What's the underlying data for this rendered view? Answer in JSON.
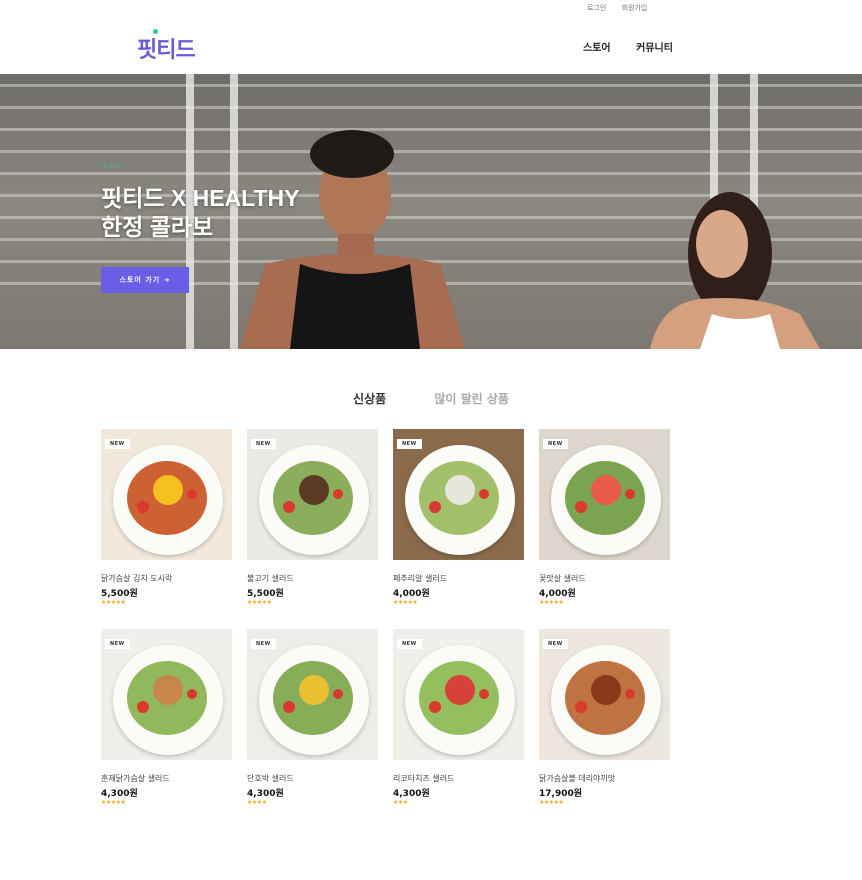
{
  "top_links": {
    "login": "로그인",
    "signup": "회원가입"
  },
  "logo": {
    "text": "핏티드"
  },
  "nav": {
    "store": "스토어",
    "community": "커뮤니티"
  },
  "hero": {
    "sub": "⚘⚘⚘",
    "title_line1": "핏티드 X HEALTHY",
    "title_line2": "한정 콜라보",
    "button": "스토어 가기 ➔"
  },
  "tabs": {
    "new": "신상품",
    "best": "많이 팔린 상품"
  },
  "products": [
    {
      "badge": "NEW",
      "name": "닭가슴살 김치 도시락",
      "price": "5,500원",
      "stars": "★★★★★",
      "colors": [
        "#f2e9dc",
        "#c8501e",
        "#f6c021"
      ]
    },
    {
      "badge": "NEW",
      "name": "불고기 샐러드",
      "price": "5,500원",
      "stars": "★★★★★",
      "colors": [
        "#eceae4",
        "#7da54a",
        "#5a3a22"
      ]
    },
    {
      "badge": "NEW",
      "name": "페추리알 샐러드",
      "price": "4,000원",
      "stars": "★★★★★",
      "colors": [
        "#8a6a4a",
        "#98b85a",
        "#e8e6da"
      ]
    },
    {
      "badge": "NEW",
      "name": "꽃맛살 샐러드",
      "price": "4,000원",
      "stars": "★★★★★",
      "colors": [
        "#ddd6cc",
        "#6b9a3c",
        "#e85a4a"
      ]
    },
    {
      "badge": "NEW",
      "name": "훈제닭가슴살 샐러드",
      "price": "4,300원",
      "stars": "★★★★★",
      "colors": [
        "#eef0ea",
        "#86b04a",
        "#c8864a"
      ]
    },
    {
      "badge": "NEW",
      "name": "단호박 샐러드",
      "price": "4,300원",
      "stars": "★★★★",
      "colors": [
        "#eceee8",
        "#7aa446",
        "#e8c030"
      ]
    },
    {
      "badge": "NEW",
      "name": "리코타치즈 샐러드",
      "price": "4,300원",
      "stars": "★★★",
      "colors": [
        "#eef0ea",
        "#8ab84e",
        "#d8403a"
      ]
    },
    {
      "badge": "NEW",
      "name": "닭가슴살볼 데리야끼맛",
      "price": "17,900원",
      "stars": "★★★★★",
      "colors": [
        "#ece6de",
        "#b8642e",
        "#8a3a1a"
      ]
    }
  ]
}
